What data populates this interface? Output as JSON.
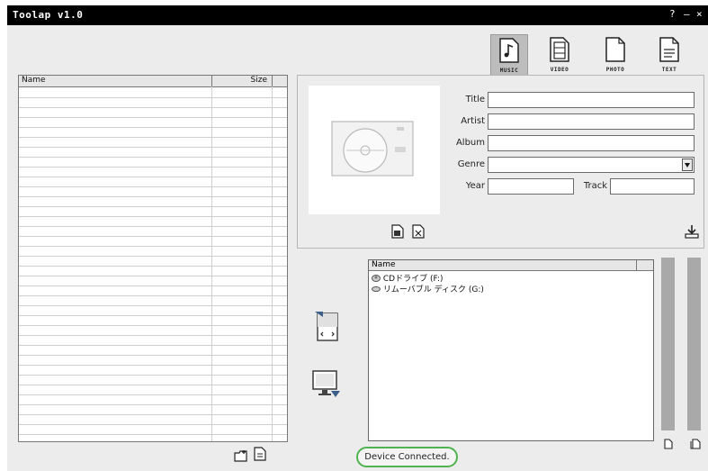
{
  "window": {
    "title": "Toolap v1.0",
    "controls": {
      "help": "?",
      "minimize": "–",
      "close": "×"
    }
  },
  "media_types": [
    {
      "label": "MUSIC",
      "icon": "music-note-icon",
      "active": true
    },
    {
      "label": "VIDEO",
      "icon": "video-film-icon",
      "active": false
    },
    {
      "label": "PHOTO",
      "icon": "photo-icon",
      "active": false
    },
    {
      "label": "TEXT",
      "icon": "text-document-icon",
      "active": false
    }
  ],
  "file_list": {
    "columns": [
      "Name",
      "Size"
    ],
    "rows": []
  },
  "tags": {
    "title_label": "Title",
    "artist_label": "Artist",
    "album_label": "Album",
    "genre_label": "Genre",
    "year_label": "Year",
    "track_label": "Track",
    "title_value": "",
    "artist_value": "",
    "album_value": "",
    "genre_value": "",
    "year_value": "",
    "track_value": ""
  },
  "device_tree": {
    "header": "Name",
    "items": [
      {
        "label": "CDドライブ (F:)",
        "icon": "cd-drive-icon"
      },
      {
        "label": "リムーバブル ディスク (G:)",
        "icon": "removable-disk-icon"
      }
    ]
  },
  "status": {
    "text": "Device Connected."
  },
  "colors": {
    "status_ring": "#4fb34f",
    "titlebar": "#000000",
    "window_bg": "#ececec"
  }
}
